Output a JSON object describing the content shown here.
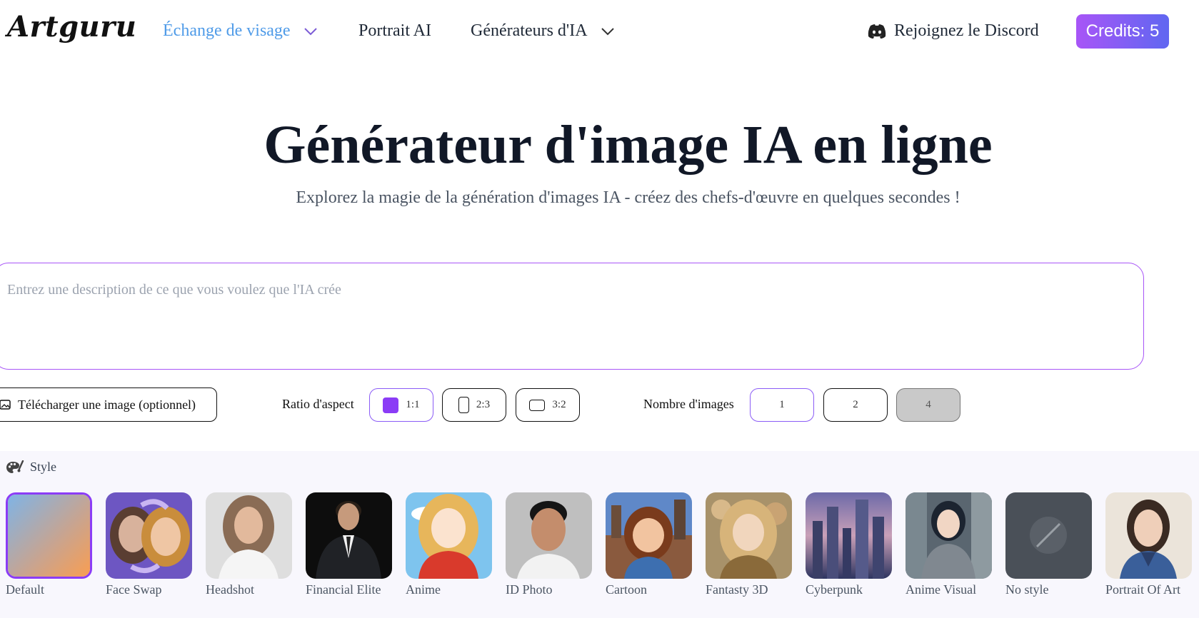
{
  "nav": {
    "logo": "Artguru",
    "items": [
      {
        "label": "Échange de visage"
      },
      {
        "label": "Portrait AI"
      },
      {
        "label": "Générateurs d'IA"
      }
    ],
    "discord": "Rejoignez le Discord",
    "credits": "Credits: 5"
  },
  "hero": {
    "title": "Générateur d'image IA en ligne",
    "subtitle": "Explorez la magie de la génération d'images IA - créez des chefs-d'œuvre en quelques secondes !"
  },
  "prompt": {
    "placeholder": "Entrez une description de ce que vous voulez que l'IA crée"
  },
  "options": {
    "upload_label": "Télécharger une image (optionnel)",
    "aspect_label": "Ratio d'aspect",
    "aspects": [
      "1:1",
      "2:3",
      "3:2"
    ],
    "selected_aspect": "1:1",
    "count_label": "Nombre d'images",
    "counts": [
      "1",
      "2",
      "4"
    ],
    "selected_count": "1",
    "disabled_count": "4"
  },
  "styles": {
    "heading": "Style",
    "selected": "Default",
    "items": [
      {
        "label": "Default"
      },
      {
        "label": "Face Swap"
      },
      {
        "label": "Headshot"
      },
      {
        "label": "Financial Elite"
      },
      {
        "label": "Anime"
      },
      {
        "label": "ID Photo"
      },
      {
        "label": "Cartoon"
      },
      {
        "label": "Fantasty 3D"
      },
      {
        "label": "Cyberpunk"
      },
      {
        "label": "Anime Visual"
      },
      {
        "label": "No style"
      },
      {
        "label": "Portrait Of Art"
      }
    ]
  },
  "colors": {
    "accent": "#8b5cf6",
    "credits_gradient": [
      "#a855f7",
      "#6366f1"
    ],
    "active_nav": "#4f9be8"
  }
}
